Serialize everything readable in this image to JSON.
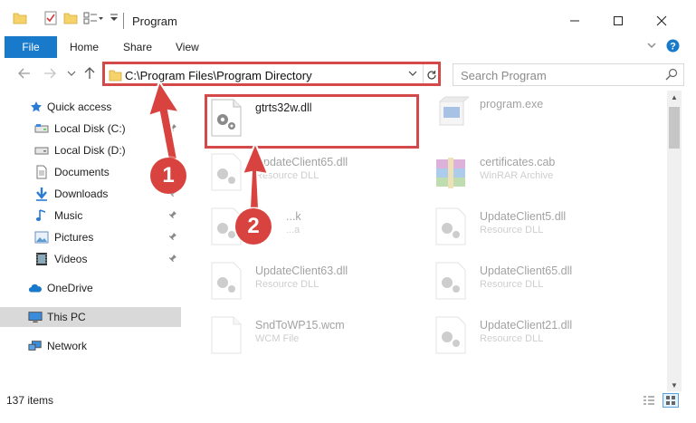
{
  "window": {
    "title": "Program",
    "minimize_glyph": "—",
    "maximize_glyph": "☐",
    "close_glyph": "✕"
  },
  "ribbon": {
    "tabs": [
      {
        "label": "File"
      },
      {
        "label": "Home"
      },
      {
        "label": "Share"
      },
      {
        "label": "View"
      }
    ]
  },
  "navigation": {
    "address": "C:\\Program Files\\Program Directory",
    "search_placeholder": "Search Program"
  },
  "sidebar": {
    "items": [
      {
        "label": "Quick access",
        "icon": "star-icon"
      },
      {
        "label": "Local Disk (C:)",
        "icon": "drive-icon"
      },
      {
        "label": "Local Disk (D:)",
        "icon": "drive-icon"
      },
      {
        "label": "Documents",
        "icon": "documents-icon"
      },
      {
        "label": "Downloads",
        "icon": "download-icon"
      },
      {
        "label": "Music",
        "icon": "music-icon"
      },
      {
        "label": "Pictures",
        "icon": "pictures-icon"
      },
      {
        "label": "Videos",
        "icon": "videos-icon"
      },
      {
        "label": "OneDrive",
        "icon": "cloud-icon"
      },
      {
        "label": "This PC",
        "icon": "computer-icon"
      },
      {
        "label": "Network",
        "icon": "network-icon"
      }
    ]
  },
  "files": [
    {
      "name": "gtrts32w.dll",
      "type": "",
      "icon": "dll-gear-icon"
    },
    {
      "name": "program.exe",
      "type": "",
      "icon": "exe-icon"
    },
    {
      "name": "UpdateClient65.dll",
      "type": "Resource DLL",
      "icon": "dll-gear-icon"
    },
    {
      "name": "certificates.cab",
      "type": "WinRAR Archive",
      "icon": "archive-icon"
    },
    {
      "name": "...k",
      "type": "...a",
      "icon": "dll-gear-icon"
    },
    {
      "name": "UpdateClient5.dll",
      "type": "Resource DLL",
      "icon": "dll-gear-icon"
    },
    {
      "name": "UpdateClient63.dll",
      "type": "Resource DLL",
      "icon": "dll-gear-icon"
    },
    {
      "name": "UpdateClient65.dll",
      "type": "Resource DLL",
      "icon": "dll-gear-icon"
    },
    {
      "name": "SndToWP15.wcm",
      "type": "WCM File",
      "icon": "file-icon"
    },
    {
      "name": "UpdateClient21.dll",
      "type": "Resource DLL",
      "icon": "dll-gear-icon"
    }
  ],
  "status": {
    "item_count": "137 items"
  },
  "annotations": {
    "step1": "1",
    "step2": "2",
    "color": "#d44a4a"
  }
}
